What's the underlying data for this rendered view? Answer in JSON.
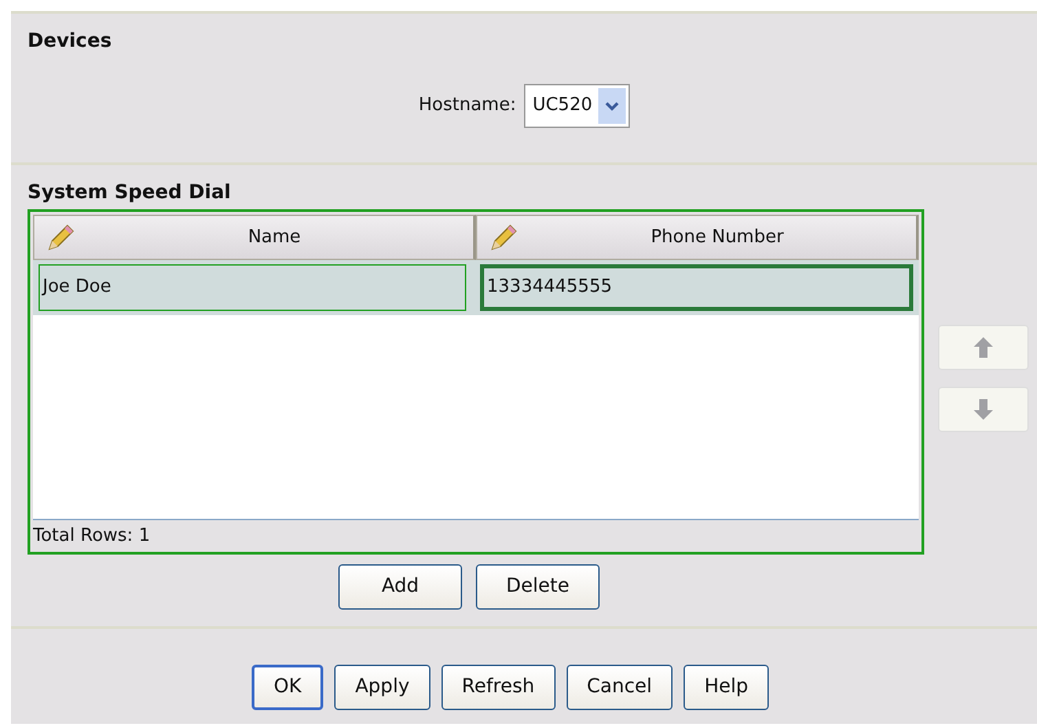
{
  "devices": {
    "title": "Devices",
    "hostname_label": "Hostname:",
    "hostname_value": "UC520"
  },
  "speed_dial": {
    "title": "System Speed Dial",
    "columns": [
      "Name",
      "Phone Number"
    ],
    "rows": [
      {
        "selected": true,
        "cells": [
          {
            "text": "Joe Doe",
            "focused": false
          },
          {
            "text": "13334445555",
            "focused": true
          }
        ]
      }
    ],
    "footer": "Total Rows: 1",
    "move_buttons": [
      {
        "kind": "up",
        "disabled": true
      },
      {
        "kind": "down",
        "disabled": true
      }
    ],
    "buttons": [
      "Add",
      "Delete"
    ]
  },
  "buttons": [
    {
      "label": "OK",
      "default": true
    },
    {
      "label": "Apply",
      "default": false
    },
    {
      "label": "Refresh",
      "default": false
    },
    {
      "label": "Cancel",
      "default": false
    },
    {
      "label": "Help",
      "default": false
    }
  ]
}
